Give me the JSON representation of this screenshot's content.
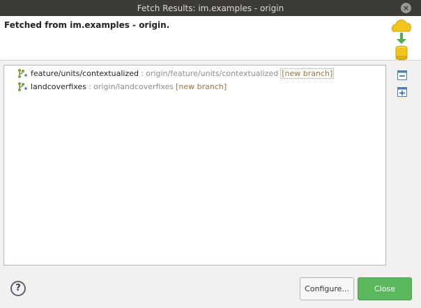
{
  "window": {
    "title": "Fetch Results: im.examples - origin"
  },
  "header": {
    "title": "Fetched from im.examples - origin."
  },
  "results": [
    {
      "name": "feature/units/contextualized",
      "remote": ": origin/feature/units/contextualized",
      "status": "[new branch]"
    },
    {
      "name": "landcoverfixes",
      "remote": ": origin/landcoverfixes",
      "status": "[new branch]"
    }
  ],
  "buttons": {
    "configure": "Configure...",
    "close": "Close"
  },
  "help": {
    "glyph": "?"
  },
  "colors": {
    "accent": "#5cb85c",
    "status": "#a4713b"
  }
}
